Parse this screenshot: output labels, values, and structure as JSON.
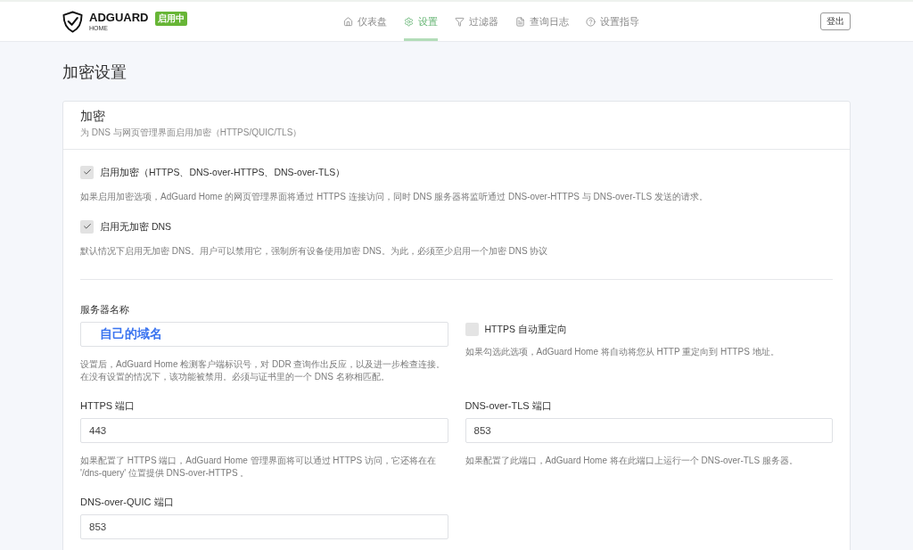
{
  "header": {
    "logo": {
      "title": "ADGUARD",
      "subtitle": "HOME"
    },
    "status_badge": "启用中",
    "nav": [
      {
        "label": "仪表盘",
        "selected": false
      },
      {
        "label": "设置",
        "selected": true
      },
      {
        "label": "过滤器",
        "selected": false
      },
      {
        "label": "查询日志",
        "selected": false
      },
      {
        "label": "设置指导",
        "selected": false
      }
    ],
    "logout_button": "登出"
  },
  "page_title": "加密设置",
  "card": {
    "title": "加密",
    "subtitle": "为 DNS 与网页管理界面启用加密（HTTPS/QUIC/TLS）",
    "options": [
      {
        "label": "启用加密（HTTPS、DNS-over-HTTPS、DNS-over-TLS）",
        "checked": true,
        "description": "如果启用加密选项，AdGuard Home 的网页管理界面将通过 HTTPS 连接访问，同时 DNS 服务器将监听通过 DNS-over-HTTPS 与 DNS-over-TLS 发送的请求。"
      },
      {
        "label": "启用无加密 DNS",
        "checked": true,
        "description": "默认情况下启用无加密 DNS。用户可以禁用它，强制所有设备使用加密 DNS。为此，必须至少启用一个加密 DNS 协议"
      }
    ],
    "settings": [
      {
        "kind": "text_field",
        "label": "服务器名称",
        "value": "自己的域名",
        "highlighted": true,
        "description": "设置后，AdGuard Home 检测客户端标识号，对 DDR 查询作出反应，以及进一步检查连接。在没有设置的情况下，该功能被禁用。必须与证书里的一个 DNS 名称相匹配。"
      },
      {
        "kind": "checkbox",
        "label": "HTTPS 自动重定向",
        "checked": false,
        "description": "如果勾选此选项，AdGuard Home 将自动将您从 HTTP 重定向到 HTTPS 地址。"
      },
      {
        "kind": "text_field",
        "label": "HTTPS 端口",
        "value": "443",
        "highlighted": false,
        "description": "如果配置了 HTTPS 端口，AdGuard Home 管理界面将可以通过 HTTPS 访问，它还将在在 '/dns-query' 位置提供 DNS-over-HTTPS 。"
      },
      {
        "kind": "text_field",
        "label": "DNS-over-TLS 端口",
        "value": "853",
        "highlighted": false,
        "description": "如果配置了此端口，AdGuard Home 将在此端口上运行一个 DNS-over-TLS 服务器。"
      },
      {
        "kind": "text_field",
        "label": "DNS-over-QUIC 端口",
        "value": "853",
        "highlighted": false
      }
    ]
  }
}
